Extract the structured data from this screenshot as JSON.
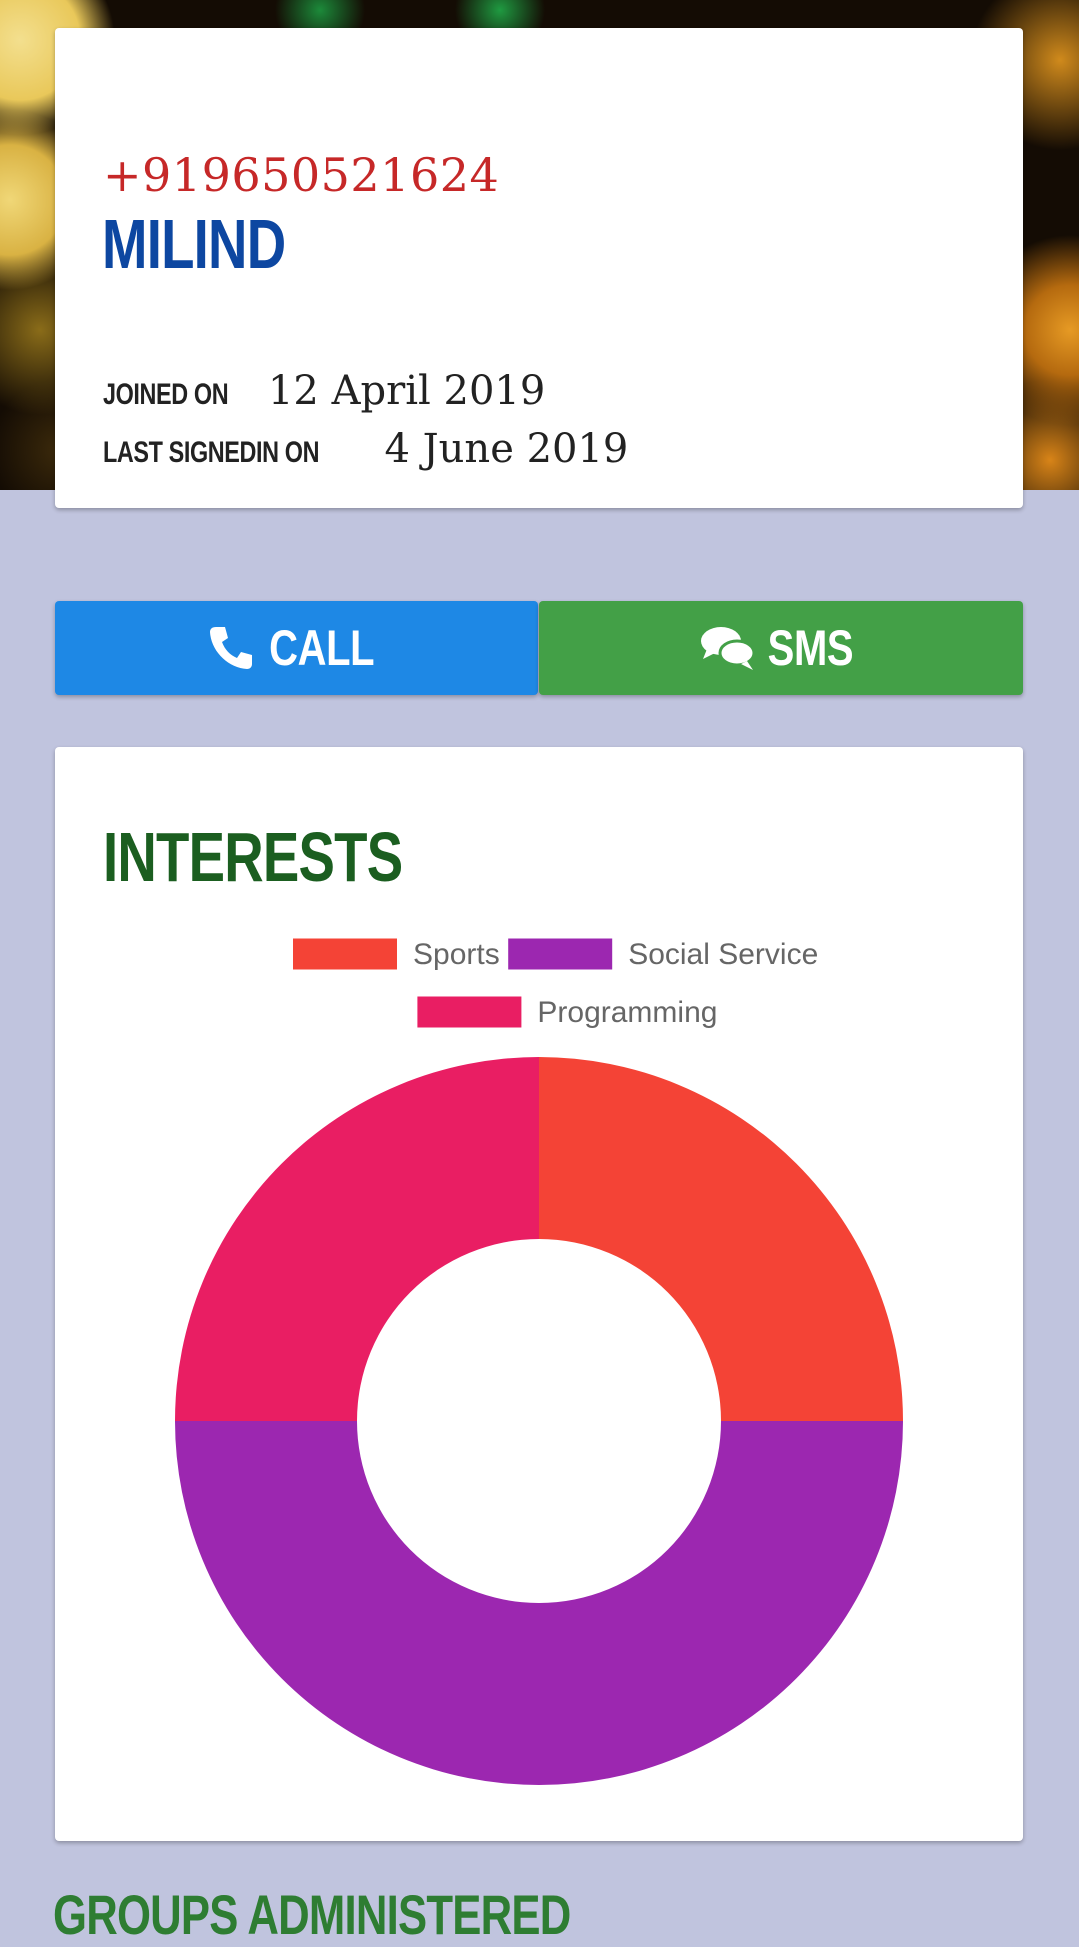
{
  "profile": {
    "phone": "+919650521624",
    "name": "Milind",
    "joined_label": "Joined on",
    "joined_date": "12 April 2019",
    "last_signed_label": "Last SignedIn on",
    "last_signed_date": "4 June 2019"
  },
  "actions": {
    "call_label": "Call",
    "call_icon": "phone-icon",
    "sms_label": "SMS",
    "sms_icon": "comments-icon"
  },
  "interests": {
    "title": "Interests"
  },
  "groups": {
    "title": "Groups Administered"
  },
  "colors": {
    "call": "#1e88e5",
    "sms": "#43a047",
    "phone_text": "#c62828",
    "name_text": "#0d47a1",
    "interests_title": "#1b5e20",
    "page_bg": "#c0c4de"
  },
  "chart_data": {
    "type": "pie",
    "variant": "doughnut",
    "legend_placement": "top",
    "series": [
      {
        "name": "Sports",
        "value": 1,
        "color": "#f44336"
      },
      {
        "name": "Social Service",
        "value": 2,
        "color": "#9c27b0"
      },
      {
        "name": "Programming",
        "value": 1,
        "color": "#e91e63"
      }
    ]
  }
}
